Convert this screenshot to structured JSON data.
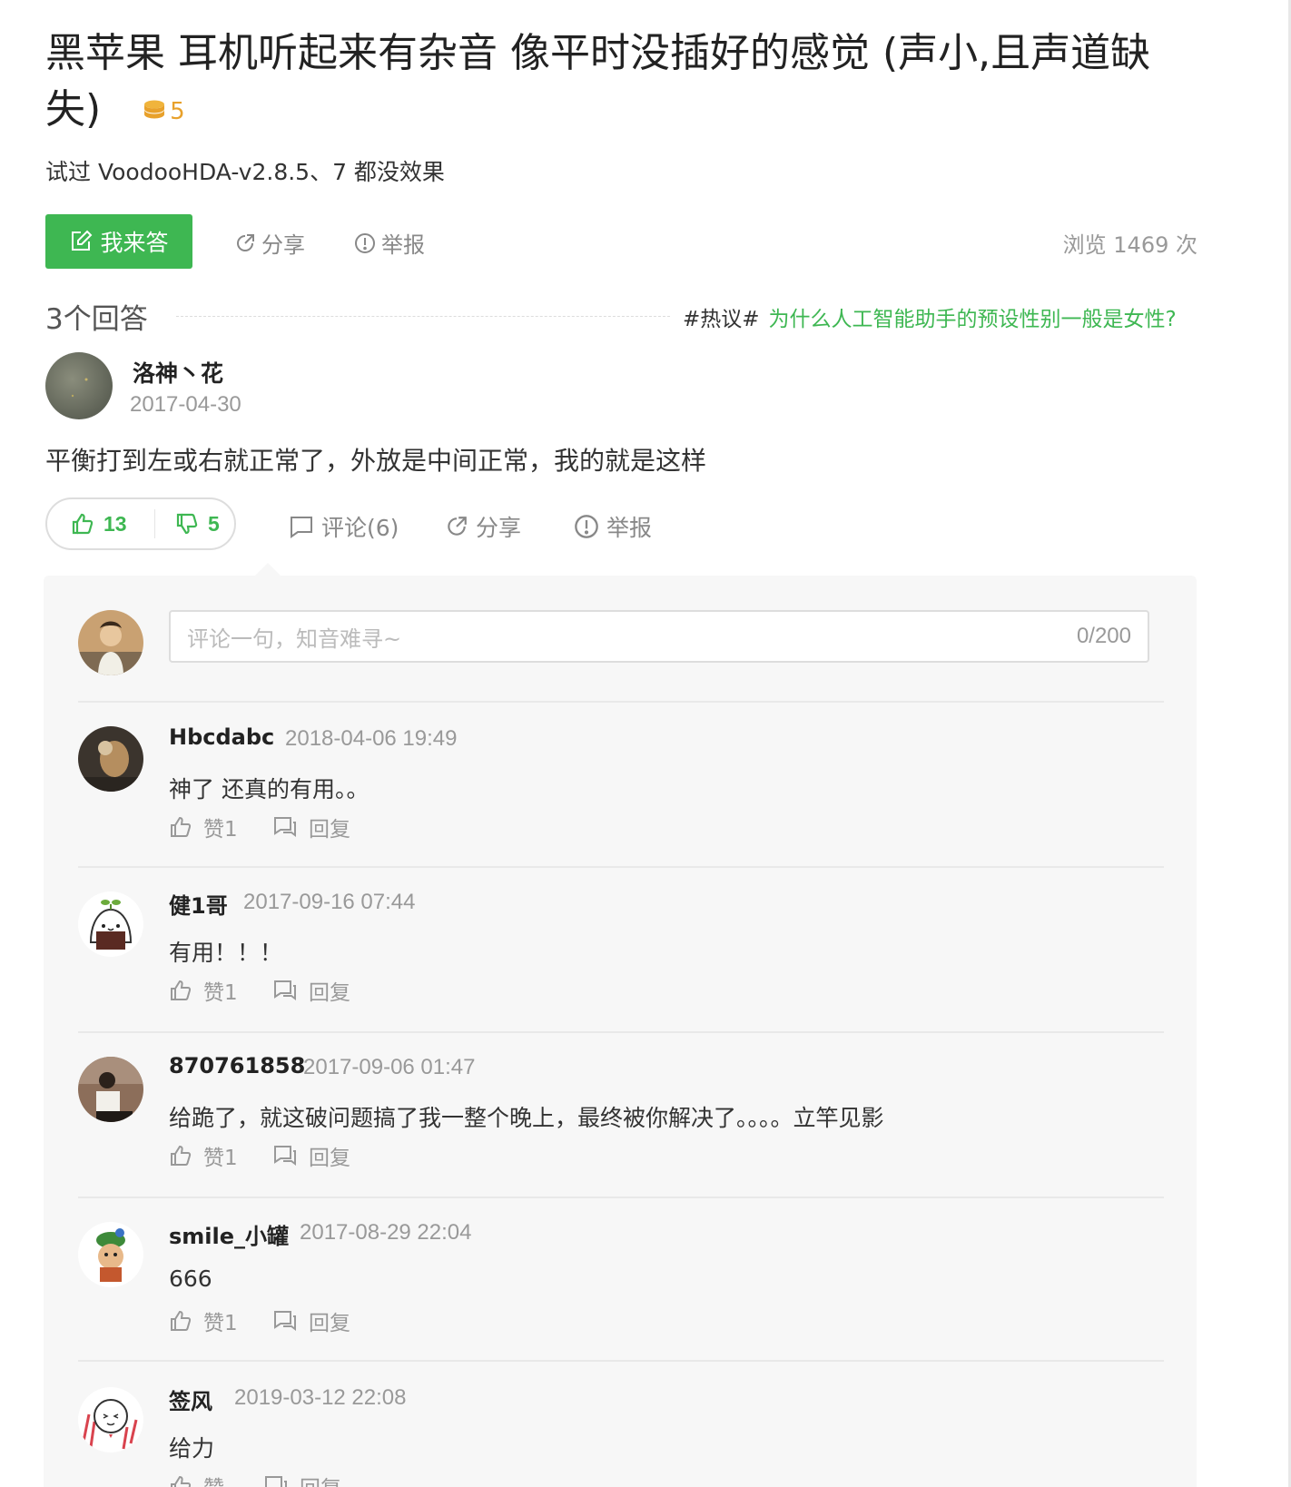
{
  "question": {
    "title": "黑苹果 耳机听起来有杂音 像平时没插好的感觉 (声小,且声道缺失)",
    "reward": "5",
    "description": "试过 VoodooHDA-v2.8.5、7 都没效果",
    "answer_button": "我来答",
    "share": "分享",
    "report": "举报",
    "views": "浏览 1469 次"
  },
  "answers_header": {
    "count": "3个回答",
    "hot_tag": "#热议#",
    "hot_link": "为什么人工智能助手的预设性别一般是女性?"
  },
  "answer": {
    "author": "洛神丶花",
    "date": "2017-04-30",
    "body": "平衡打到左或右就正常了，外放是中间正常，我的就是这样",
    "upvotes": "13",
    "downvotes": "5",
    "comments": "评论(6)",
    "share": "分享",
    "report": "举报"
  },
  "comment_input": {
    "placeholder": "评论一句，知音难寻~",
    "counter": "0/200"
  },
  "comments": [
    {
      "name": "Hbcdabc",
      "time": "2018-04-06 19:49",
      "text": "神了 还真的有用。。",
      "like": "赞1",
      "reply": "回复"
    },
    {
      "name": "健1哥",
      "time": "2017-09-16 07:44",
      "text": "有用！！！",
      "like": "赞1",
      "reply": "回复"
    },
    {
      "name": "870761858",
      "time": "2017-09-06 01:47",
      "text": "给跪了，就这破问题搞了我一整个晚上，最终被你解决了。。。。立竿见影",
      "like": "赞1",
      "reply": "回复"
    },
    {
      "name": "smile_小罐",
      "time": "2017-08-29 22:04",
      "text": "666",
      "like": "赞1",
      "reply": "回复"
    },
    {
      "name": "签风",
      "time": "2019-03-12 22:08",
      "text": "给力",
      "like": "赞",
      "reply": "回复"
    }
  ],
  "colors": {
    "accent": "#3eb752",
    "coin": "#e8a12b",
    "panel": "#f7f7f7"
  }
}
